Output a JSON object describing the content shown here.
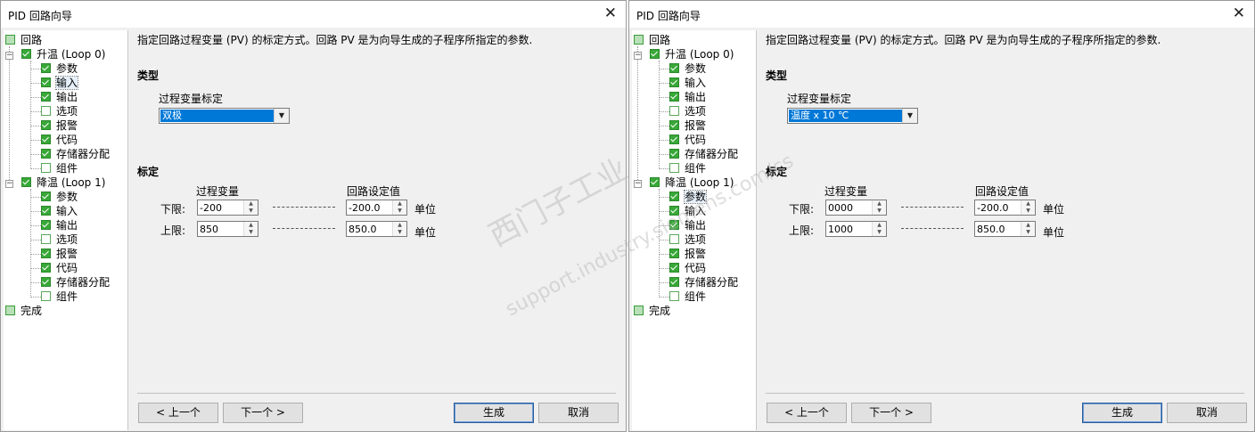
{
  "watermark": {
    "line1": "西门子工业",
    "line2": "support.industry.siemens.com/cs"
  },
  "tree": {
    "root": "回路",
    "loop0": "升温 (Loop 0)",
    "loop1": "降温 (Loop 1)",
    "children": [
      "参数",
      "输入",
      "输出",
      "选项",
      "报警",
      "代码",
      "存储器分配",
      "组件"
    ],
    "done": "完成"
  },
  "dialogs": [
    {
      "title": "PID 回路向导",
      "description": "指定回路过程变量 (PV) 的标定方式。回路 PV 是为向导生成的子程序所指定的参数.",
      "type_header": "类型",
      "pv_scale_label": "过程变量标定",
      "pv_scale_value": "双极",
      "scale_header": "标定",
      "col_pv": "过程变量",
      "col_sp": "回路设定值",
      "lower_label": "下限:",
      "upper_label": "上限:",
      "lower_pv": "-200",
      "upper_pv": "850",
      "lower_sp": "-200.0",
      "upper_sp": "850.0",
      "unit": "单位",
      "btn_prev": "< 上一个",
      "btn_next": "下一个 >",
      "btn_generate": "生成",
      "btn_cancel": "取消"
    },
    {
      "title": "PID 回路向导",
      "description": "指定回路过程变量 (PV) 的标定方式。回路 PV 是为向导生成的子程序所指定的参数.",
      "type_header": "类型",
      "pv_scale_label": "过程变量标定",
      "pv_scale_value": "温度 x 10 ℃",
      "scale_header": "标定",
      "col_pv": "过程变量",
      "col_sp": "回路设定值",
      "lower_label": "下限:",
      "upper_label": "上限:",
      "lower_pv": "0000",
      "upper_pv": "1000",
      "lower_sp": "-200.0",
      "upper_sp": "850.0",
      "unit": "单位",
      "btn_prev": "< 上一个",
      "btn_next": "下一个 >",
      "btn_generate": "生成",
      "btn_cancel": "取消"
    }
  ]
}
